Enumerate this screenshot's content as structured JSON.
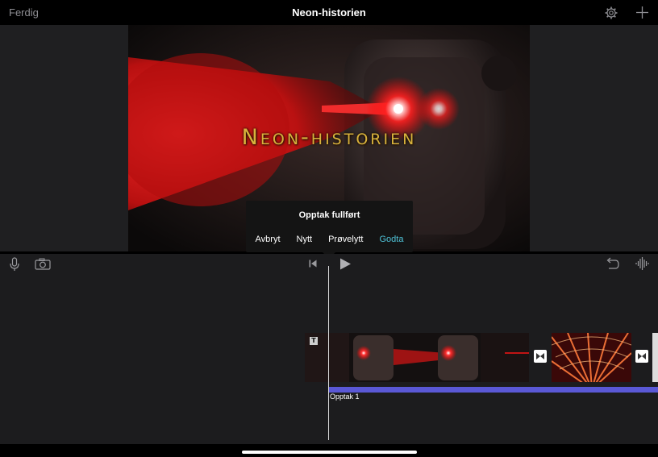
{
  "header": {
    "done_label": "Ferdig",
    "project_title": "Neon-historien",
    "settings_icon": "gear-icon",
    "add_icon": "plus-icon"
  },
  "viewer": {
    "title_overlay": "Neon-historien"
  },
  "popup": {
    "title": "Opptak fullført",
    "actions": [
      "Avbryt",
      "Nytt",
      "Prøvelytt",
      "Godta"
    ],
    "accent_color": "#4fc3d8"
  },
  "toolbar": {
    "left_icons": [
      "microphone-icon",
      "camera-icon"
    ],
    "center_icons": [
      "skip-to-start-icon",
      "play-icon"
    ],
    "right_icons": [
      "undo-icon",
      "audio-waveform-icon"
    ]
  },
  "timeline": {
    "audio_track_label": "Opptak 1",
    "audio_track_color": "#5a58d6"
  }
}
